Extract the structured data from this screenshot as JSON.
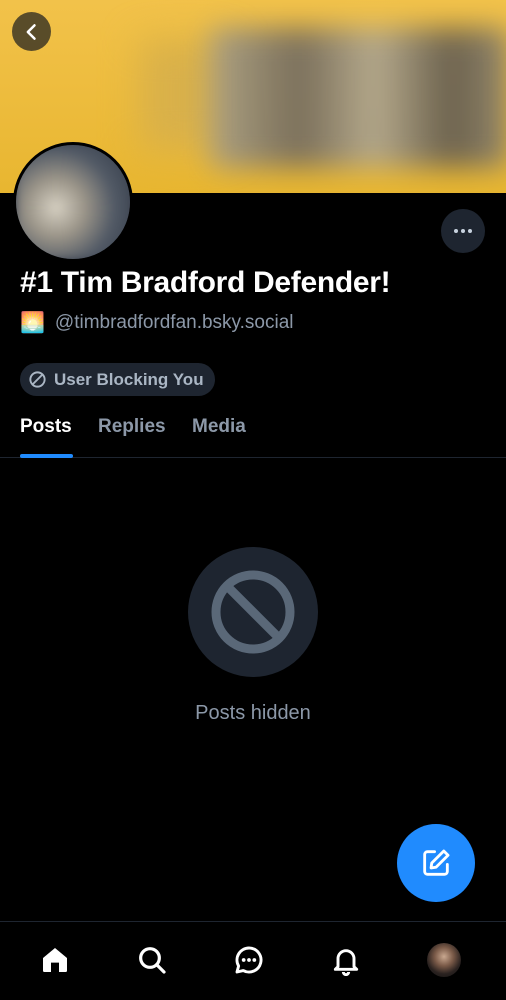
{
  "profile": {
    "display_name": "#1 Tim Bradford Defender!",
    "emoji": "🌅",
    "handle": "@timbradfordfan.bsky.social",
    "blocking_label": "User Blocking You"
  },
  "tabs": [
    {
      "label": "Posts",
      "active": true
    },
    {
      "label": "Replies",
      "active": false
    },
    {
      "label": "Media",
      "active": false
    }
  ],
  "feed": {
    "hidden_message": "Posts hidden",
    "icon": "block-icon"
  },
  "nav": {
    "items": [
      "home-icon",
      "search-icon",
      "chat-icon",
      "bell-icon",
      "avatar"
    ]
  },
  "colors": {
    "accent": "#208bfe",
    "banner": "#f2c24a",
    "muted_text": "#8c98a8",
    "surface": "#1e2530"
  }
}
